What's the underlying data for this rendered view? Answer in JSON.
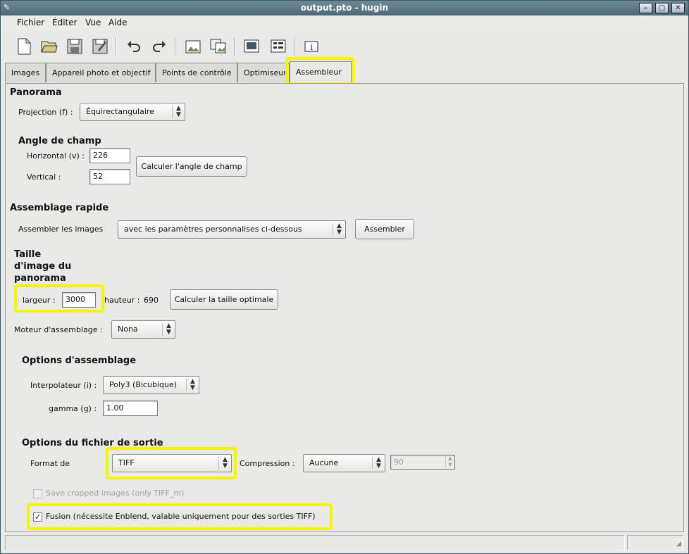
{
  "window": {
    "title": "output.pto - hugin"
  },
  "menu": [
    "Fichier",
    "Éditer",
    "Vue",
    "Aide"
  ],
  "toolbar_icons": [
    "new-document-icon",
    "open-folder-icon",
    "save-icon",
    "save-as-icon",
    "undo-icon",
    "redo-icon",
    "add-image-icon",
    "add-images-series-icon",
    "preview-icon",
    "panorama-editor-icon",
    "info-icon"
  ],
  "tabs": [
    "Images",
    "Appareil photo et objectif",
    "Points de contrôle",
    "Optimiseur",
    "Assembleur"
  ],
  "panorama": {
    "heading": "Panorama",
    "projection_label": "Projection (f) :",
    "projection_value": "Équirectangulaire"
  },
  "angle": {
    "heading": "Angle de champ",
    "horizontal_label": "Horizontal (v) :",
    "horizontal_value": "226",
    "vertical_label": "Vertical :",
    "vertical_value": "52",
    "calc_button": "Calculer l'angle de champ"
  },
  "quick": {
    "heading": "Assemblage rapide",
    "label": "Assembler les images",
    "combo_value": "avec les paramètres personnalises ci-dessous",
    "button": "Assembler"
  },
  "size": {
    "heading_line1": "Taille",
    "heading_line2": "d'image du",
    "heading_line3": "panorama",
    "width_label": "largeur :",
    "width_value": "3000",
    "height_label": "hauteur :",
    "height_value": "690",
    "optimal_button": "Calculer la taille optimale"
  },
  "engine": {
    "label": "Moteur d'assemblage :",
    "value": "Nona"
  },
  "options": {
    "heading": "Options d'assemblage",
    "interp_label": "Interpolateur (i) :",
    "interp_value": "Poly3 (Bicubique)",
    "gamma_label": "gamma (g) :",
    "gamma_value": "1.00"
  },
  "output": {
    "heading": "Options du fichier de sortie",
    "format_label": "Format de",
    "format_value": "TIFF",
    "compression_label": "Compression :",
    "compression_value": "Aucune",
    "quality_value": "90",
    "save_cropped_label": "Save cropped images (only TIFF_m)",
    "fusion_label": "Fusion (nécessite Enblend, valable uniquement pour des sorties TIFF)",
    "fusion_checked": true
  },
  "colors": {
    "highlight": "#f5f500",
    "titlebar": "#5a7584"
  }
}
